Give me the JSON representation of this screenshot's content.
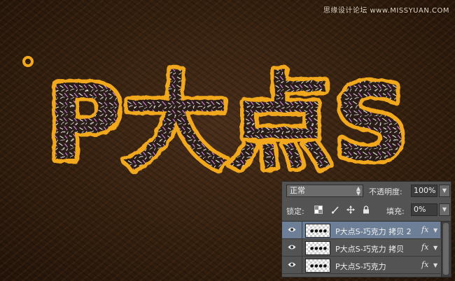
{
  "watermark": "思缘设计论坛 www.MISSYUAN.COM",
  "artwork": {
    "text": "P大点S",
    "colors": {
      "outline": "#f2a81c",
      "outline_dark": "#b86a0a",
      "fill": "#2a1c16",
      "sprinkle_a": "#d9d9d9",
      "sprinkle_b": "#c77bd8"
    }
  },
  "layers_panel": {
    "blend_mode": "正常",
    "opacity_label": "不透明度:",
    "opacity_value": "100%",
    "lock_label": "锁定:",
    "lock_icons": [
      "lock-transparent-pixels-icon",
      "lock-image-pixels-icon",
      "lock-position-icon",
      "lock-all-icon"
    ],
    "fill_label": "填充:",
    "fill_value": "0%",
    "layers": [
      {
        "name": "P大点S-巧克力 拷贝 2",
        "selected": true,
        "fx": "fx"
      },
      {
        "name": "P大点S-巧克力 拷贝",
        "selected": false,
        "fx": "fx"
      },
      {
        "name": "P大点S-巧克力",
        "selected": false,
        "fx": "fx"
      }
    ],
    "selected_color": "#6d7f96"
  }
}
